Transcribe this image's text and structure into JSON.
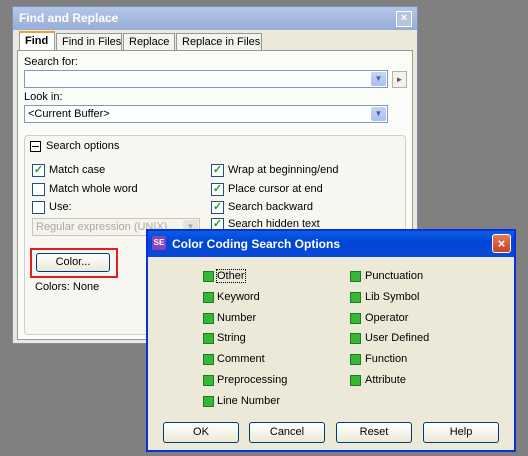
{
  "find_window": {
    "title": "Find and Replace",
    "close": "×",
    "tabs": [
      "Find",
      "Find in Files",
      "Replace",
      "Replace in Files"
    ],
    "search_for_label": "Search for:",
    "search_for_value": "",
    "look_in_label": "Look in:",
    "look_in_value": "<Current Buffer>",
    "search_options_label": "Search options",
    "options_left": [
      {
        "label": "Match case",
        "checked": true
      },
      {
        "label": "Match whole word",
        "checked": false
      },
      {
        "label": "Use:",
        "checked": false
      }
    ],
    "options_right": [
      {
        "label": "Wrap at beginning/end",
        "checked": true
      },
      {
        "label": "Place cursor at end",
        "checked": true
      },
      {
        "label": "Search backward",
        "checked": true
      },
      {
        "label": "Search hidden text",
        "checked": true
      }
    ],
    "regex_value": "Regular expression (UNIX)",
    "color_button": "Color...",
    "colors_status": "Colors: None"
  },
  "color_dialog": {
    "title": "Color Coding Search Options",
    "icon_text": "SE",
    "close": "×",
    "left_options": [
      "Other",
      "Keyword",
      "Number",
      "String",
      "Comment",
      "Preprocessing",
      "Line Number"
    ],
    "right_options": [
      "Punctuation",
      "Lib Symbol",
      "Operator",
      "User Defined",
      "Function",
      "Attribute"
    ],
    "buttons": {
      "ok": "OK",
      "cancel": "Cancel",
      "reset": "Reset",
      "help": "Help"
    }
  },
  "colors": {
    "accent_red": "#e02020",
    "check_green": "#35b835",
    "title_blue": "#0046d5"
  }
}
